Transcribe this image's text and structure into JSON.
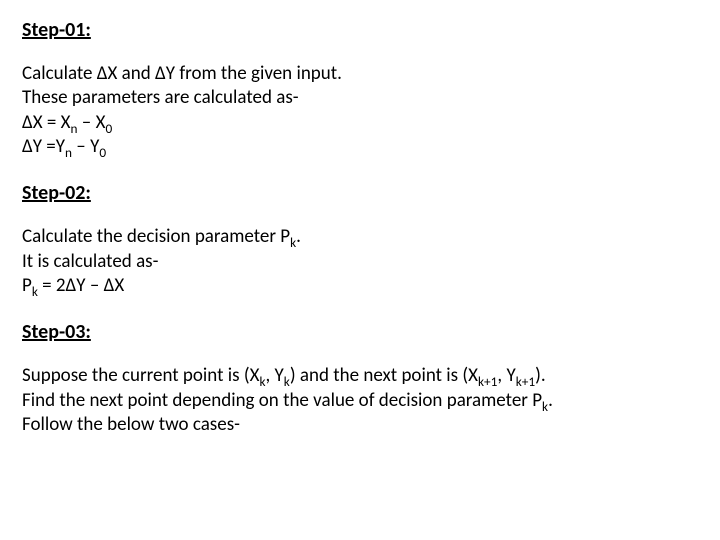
{
  "step1": {
    "heading": "Step-01:",
    "line1": "Calculate ΔX and ΔY from the given input.",
    "line2": "These parameters are calculated as-",
    "eq1_pre": "ΔX = X",
    "eq1_sub1": "n",
    "eq1_mid": " – X",
    "eq1_sub2": "0",
    "eq2_pre": "ΔY =Y",
    "eq2_sub1": "n",
    "eq2_mid": " – Y",
    "eq2_sub2": "0"
  },
  "step2": {
    "heading": "Step-02:",
    "line1_pre": "Calculate the decision parameter P",
    "line1_sub": "k",
    "line1_post": ".",
    "line2": "It is calculated as-",
    "eq_pre": "P",
    "eq_sub": "k",
    "eq_post": " = 2ΔY – ΔX"
  },
  "step3": {
    "heading": "Step-03:",
    "line1_a": "Suppose the current point is (X",
    "line1_s1": "k",
    "line1_b": ", Y",
    "line1_s2": "k",
    "line1_c": ") and the next point is (X",
    "line1_s3": "k+1",
    "line1_d": ", Y",
    "line1_s4": "k+1",
    "line1_e": ").",
    "line2_a": "Find the next point depending on the value of decision parameter P",
    "line2_s": "k",
    "line2_b": ".",
    "line3": "Follow the below two cases-"
  }
}
